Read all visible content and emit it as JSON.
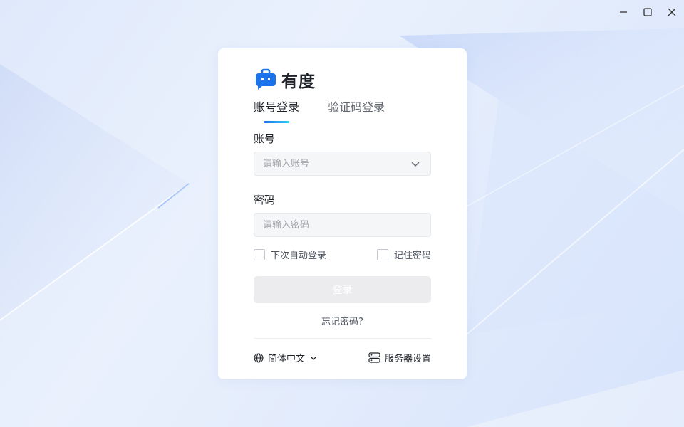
{
  "window": {
    "controls": [
      {
        "icon": "minimize-icon"
      },
      {
        "icon": "maximize-icon"
      },
      {
        "icon": "close-icon"
      }
    ]
  },
  "brand": {
    "name": "有度",
    "logo_icon": "briefcase-chat-logo",
    "logo_color": "#1a73e8"
  },
  "tabs": [
    {
      "label": "账号登录",
      "active": true
    },
    {
      "label": "验证码登录",
      "active": false
    }
  ],
  "account": {
    "label": "账号",
    "placeholder": "请输入账号",
    "value": "",
    "dropdown_icon": "chevron-down-icon"
  },
  "password": {
    "label": "密码",
    "placeholder": "请输入密码",
    "value": ""
  },
  "options": {
    "auto_login": {
      "label": "下次自动登录",
      "checked": false
    },
    "remember_password": {
      "label": "记住密码",
      "checked": false
    }
  },
  "login_button": {
    "label": "登录",
    "enabled": false
  },
  "forgot_password": {
    "label": "忘记密码?"
  },
  "footer": {
    "language": {
      "label": "简体中文",
      "icon": "globe-icon",
      "dropdown_icon": "chevron-down-icon"
    },
    "server_settings": {
      "label": "服务器设置",
      "icon": "server-icon"
    }
  },
  "colors": {
    "accent_start": "#1f6ff2",
    "accent_end": "#2bd1f2",
    "disabled_button": "#ececee"
  }
}
